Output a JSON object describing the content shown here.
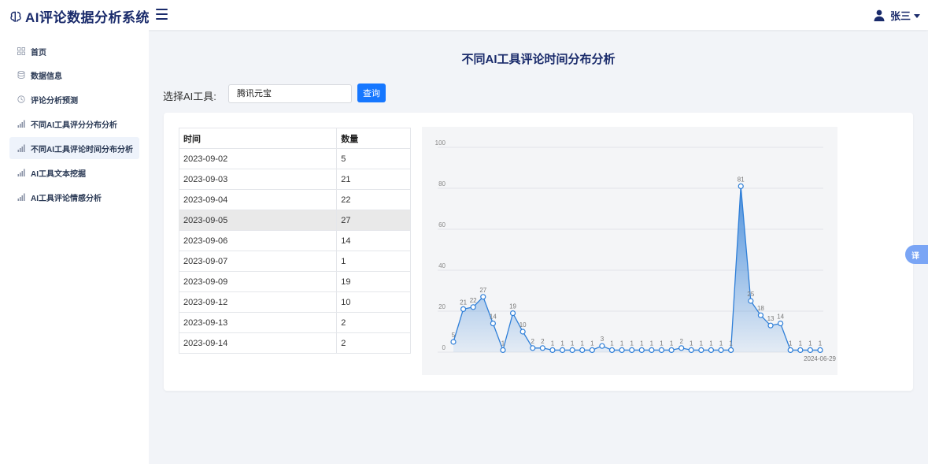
{
  "app": {
    "title": "AI评论数据分析系统"
  },
  "user": {
    "name": "张三"
  },
  "sidebar": {
    "items": [
      {
        "label": "首页",
        "icon": "grid-icon"
      },
      {
        "label": "数据信息",
        "icon": "database-icon"
      },
      {
        "label": "评论分析预测",
        "icon": "clock-icon"
      },
      {
        "label": "不同AI工具评分分布分析",
        "icon": "bar-chart-icon"
      },
      {
        "label": "不同AI工具评论时间分布分析",
        "icon": "bar-chart-icon",
        "active": true
      },
      {
        "label": "AI工具文本挖掘",
        "icon": "bar-chart-icon"
      },
      {
        "label": "AI工具评论情感分析",
        "icon": "bar-chart-icon"
      }
    ]
  },
  "main": {
    "title": "不同AI工具评论时间分布分析",
    "filter": {
      "label": "选择AI工具:",
      "value": "腾讯元宝",
      "button": "查询"
    },
    "table": {
      "headers": [
        "时间",
        "数量"
      ],
      "rows": [
        [
          "2023-09-02",
          "5"
        ],
        [
          "2023-09-03",
          "21"
        ],
        [
          "2023-09-04",
          "22"
        ],
        [
          "2023-09-05",
          "27"
        ],
        [
          "2023-09-06",
          "14"
        ],
        [
          "2023-09-07",
          "1"
        ],
        [
          "2023-09-09",
          "19"
        ],
        [
          "2023-09-12",
          "10"
        ],
        [
          "2023-09-13",
          "2"
        ],
        [
          "2023-09-14",
          "2"
        ]
      ]
    }
  },
  "translate_button": {
    "label": "译"
  },
  "colors": {
    "accent": "#1677ff",
    "brand": "#1a2b6b",
    "line": "#2f7fd8"
  },
  "chart_data": {
    "type": "area",
    "ylim": [
      0,
      100
    ],
    "yticks": [
      0,
      20,
      40,
      60,
      80,
      100
    ],
    "x": [],
    "x_last_tick": "2024-06-29",
    "values": [
      5,
      21,
      22,
      27,
      14,
      1,
      19,
      10,
      2,
      2,
      1,
      1,
      1,
      1,
      1,
      3,
      1,
      1,
      1,
      1,
      1,
      1,
      1,
      2,
      1,
      1,
      1,
      1,
      1,
      81,
      25,
      18,
      13,
      14,
      1,
      1,
      1,
      1
    ],
    "grid": true,
    "legend": "none"
  }
}
